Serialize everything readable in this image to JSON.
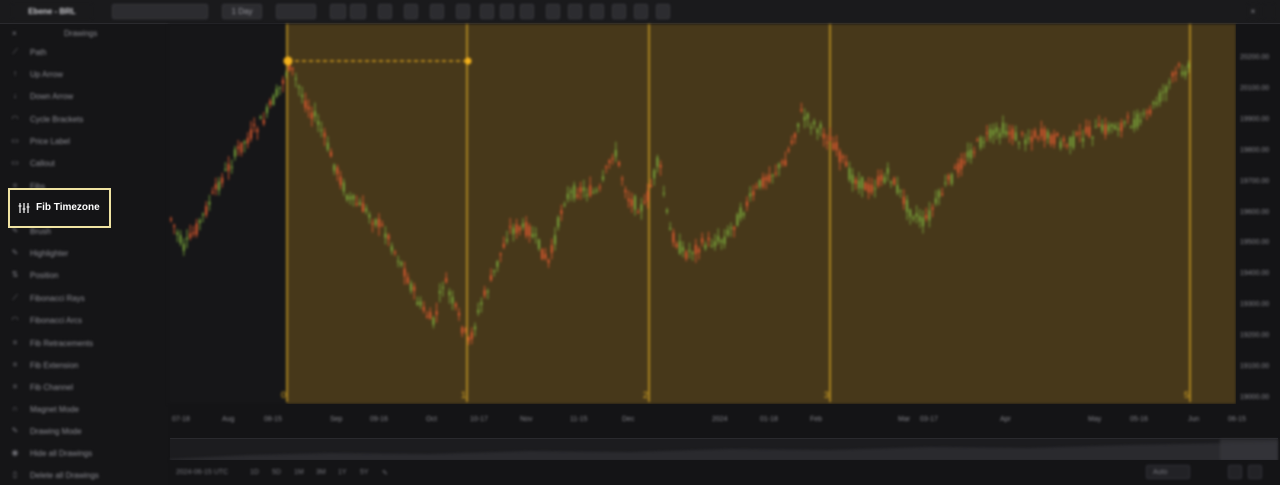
{
  "toolbar": {
    "symbol": "Ebene - BRL",
    "timeframe": "1 Day"
  },
  "sidebar": {
    "close_label": "×",
    "title": "Drawings",
    "items": [
      {
        "label": "Path",
        "icon": "path-icon"
      },
      {
        "label": "Up Arrow",
        "icon": "up-arrow-icon"
      },
      {
        "label": "Down Arrow",
        "icon": "down-arrow-icon"
      },
      {
        "label": "Cycle Brackets",
        "icon": "cycle-icon"
      },
      {
        "label": "Price Label",
        "icon": "price-label-icon"
      },
      {
        "label": "Callout",
        "icon": "callout-icon"
      },
      {
        "label": "Fibs",
        "icon": "fib-icon"
      },
      {
        "label": "Brush",
        "icon": "brush-icon"
      },
      {
        "label": "Highlighter",
        "icon": "highlighter-icon"
      },
      {
        "label": "Position",
        "icon": "position-icon"
      },
      {
        "label": "Fibonacci Rays",
        "icon": "fib-rays-icon"
      },
      {
        "label": "Fibonacci Arcs",
        "icon": "fib-arcs-icon"
      },
      {
        "label": "Fib Retracements",
        "icon": "fib-retracement-icon"
      },
      {
        "label": "Fib Extension",
        "icon": "fib-extension-icon"
      },
      {
        "label": "Fib Channel",
        "icon": "fib-channel-icon"
      },
      {
        "label": "Magnet Mode",
        "icon": "magnet-icon"
      },
      {
        "label": "Drawing Mode",
        "icon": "pencil-icon"
      },
      {
        "label": "Hide all Drawings",
        "icon": "eye-icon"
      },
      {
        "label": "Delete all Drawings",
        "icon": "trash-icon"
      }
    ],
    "selected": {
      "label": "Fib Timezone",
      "icon": "fib-timezone-icon"
    }
  },
  "chart_data": {
    "type": "candlestick",
    "drawing": "Fib Timezone",
    "timezone_labels": [
      "0",
      "1",
      "2",
      "3",
      "5"
    ],
    "y_ticks": [
      "20200.00",
      "20100.00",
      "19900.00",
      "19800.00",
      "19700.00",
      "19600.00",
      "19500.00",
      "19400.00",
      "19300.00",
      "19200.00",
      "19100.00",
      "19000.00"
    ],
    "x_ticks": [
      "07-18",
      "Aug",
      "08-15",
      "Sep",
      "09-16",
      "Oct",
      "10-17",
      "Nov",
      "11-15",
      "Dec",
      "2024",
      "01-18",
      "Feb",
      "Mar",
      "03-17",
      "Apr",
      "May",
      "05-16",
      "Jun",
      "06-15"
    ],
    "colors": {
      "up": "#7aa83a",
      "down": "#e05a2e",
      "fib_fill": "#4a3a1a",
      "fib_line": "#d8a622",
      "anchor": "#f5b21b"
    }
  },
  "bottom": {
    "datetime": "2024-06-15 UTC",
    "ranges": [
      "1D",
      "5D",
      "1M",
      "3M",
      "1Y",
      "5Y"
    ],
    "style_select": "Auto"
  }
}
